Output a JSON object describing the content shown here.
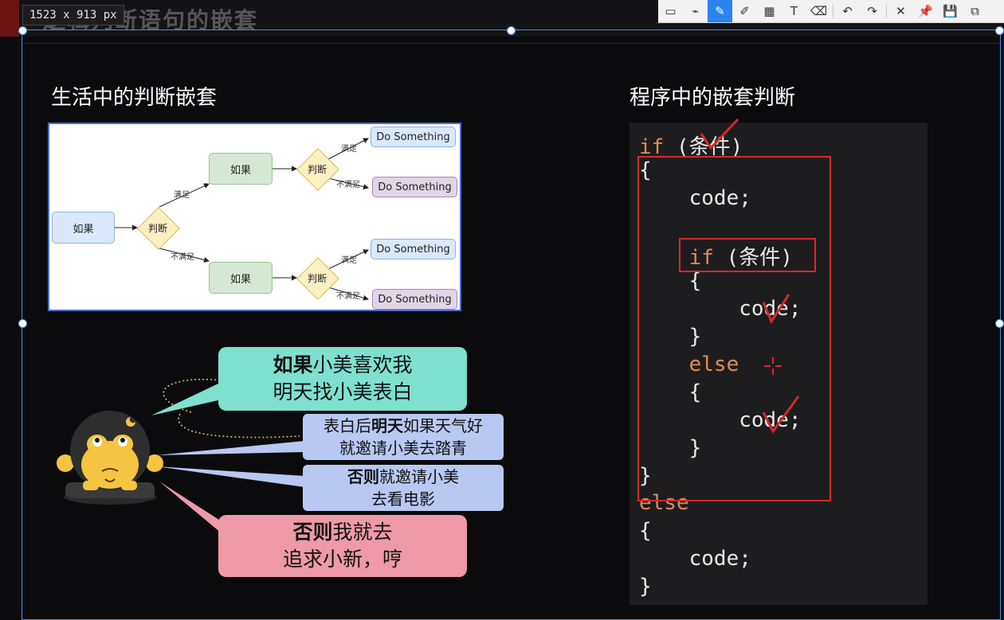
{
  "top": {
    "dimensions": "1523 x 913 px",
    "bg_title": "逻辑判断语句的嵌套"
  },
  "toolbar": {
    "tools": [
      {
        "name": "rectangle-tool-icon",
        "glyph": "▭"
      },
      {
        "name": "polyline-tool-icon",
        "glyph": "⌁"
      },
      {
        "name": "pen-tool-icon",
        "glyph": "✎"
      },
      {
        "name": "marker-tool-icon",
        "glyph": "✐"
      },
      {
        "name": "mosaic-tool-icon",
        "glyph": "▦"
      },
      {
        "name": "text-tool-icon",
        "glyph": "T"
      },
      {
        "name": "eraser-tool-icon",
        "glyph": "⌫"
      },
      {
        "name": "undo-icon",
        "glyph": "↶"
      },
      {
        "name": "redo-icon",
        "glyph": "↷"
      },
      {
        "name": "close-icon",
        "glyph": "✕"
      },
      {
        "name": "pin-icon",
        "glyph": "📌"
      },
      {
        "name": "save-icon",
        "glyph": "💾"
      },
      {
        "name": "copy-icon",
        "glyph": "⧉"
      }
    ]
  },
  "left": {
    "heading": "生活中的判断嵌套",
    "flow": {
      "root": "如果",
      "judge1": "判断",
      "upper_if": "如果",
      "lower_if": "如果",
      "judge2": "判断",
      "judge3": "判断",
      "satisfied": "满足",
      "not_satisfied": "不满足",
      "do1": "Do Something",
      "do2": "Do Something",
      "do3": "Do Something",
      "do4": "Do Something",
      "lab_up_sat": "满足",
      "lab_up_not": "不满足",
      "lab_low_sat": "满足",
      "lab_low_not": "不满足"
    },
    "bubbles": {
      "b1_bold": "如果",
      "b1_rest": "小美喜欢我",
      "b1_line2": "明天找小美表白",
      "b2_pre": "表白后",
      "b2_bold": "明天",
      "b2_rest": "如果天气好",
      "b2_line2": "就邀请小美去踏青",
      "b3_bold": "否则",
      "b3_rest": "就邀请小美",
      "b3_line2": "去看电影",
      "b4_bold": "否则",
      "b4_rest": "我就去",
      "b4_line2": "追求小新，哼"
    }
  },
  "right": {
    "heading": "程序中的嵌套判断",
    "code": {
      "l1_kw": "if",
      "l1_rest": " (条件)",
      "l2": "{",
      "l3": "    code;",
      "l4_kw": "    if",
      "l4_rest": " (条件)",
      "l5": "    {",
      "l6": "        code;",
      "l7": "    }",
      "l8_kw": "    else",
      "l9": "    {",
      "l10": "        code;",
      "l11": "    }",
      "l12": "}",
      "l13_kw": "else",
      "l14": "{",
      "l15": "    code;",
      "l16": "}"
    }
  },
  "colors": {
    "accent_blue": "#2a84ee",
    "annotation_red": "#d42a2a",
    "keyword_orange": "#e08c56",
    "bubble_teal": "#7fe0cf",
    "bubble_lavender": "#b9c8f2",
    "bubble_pink": "#ee9aa8"
  }
}
